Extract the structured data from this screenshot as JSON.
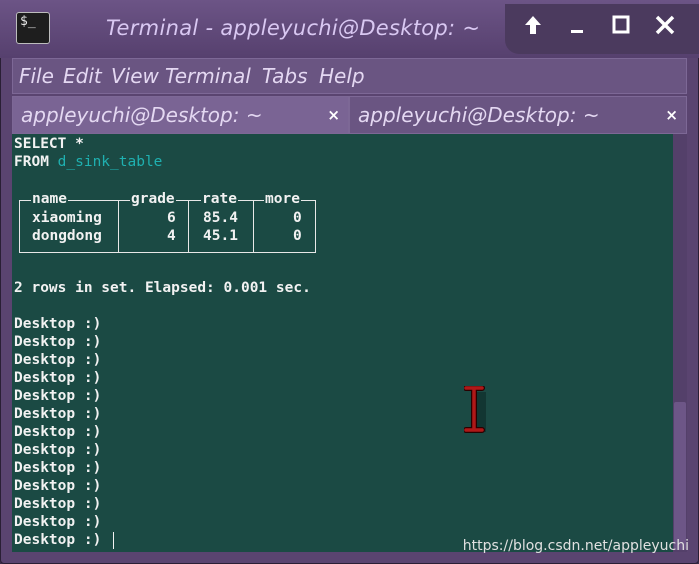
{
  "window": {
    "title": "Terminal - appleyuchi@Desktop: ~",
    "app_icon_text": "$_",
    "buttons": [
      "up-arrow-icon",
      "minimize-icon",
      "maximize-icon",
      "close-icon"
    ]
  },
  "menubar": [
    "File",
    "Edit",
    "View",
    "Terminal",
    "Tabs",
    "Help"
  ],
  "tabs": [
    {
      "label": "appleyuchi@Desktop: ~",
      "close": "×",
      "active": true
    },
    {
      "label": "appleyuchi@Desktop: ~",
      "close": "×",
      "active": false
    }
  ],
  "terminal": {
    "query_line1": "SELECT *",
    "query_from": "FROM",
    "query_table": "d_sink_table",
    "table": {
      "headers": [
        "name",
        "grade",
        "rate",
        "more"
      ],
      "rows": [
        [
          "xiaoming",
          "6",
          "85.4",
          "0"
        ],
        [
          "dongdong",
          "4",
          "45.1",
          "0"
        ]
      ]
    },
    "result_line": "2 rows in set. Elapsed: 0.001 sec.",
    "prompt": "Desktop :)",
    "prompt_count": 13
  },
  "watermark": "https://blog.csdn.net/appleyuchi",
  "colors": {
    "terminal_bg": "#1b4a44",
    "chrome": "#5a4470",
    "table_name_color": "#1fb0b0"
  }
}
